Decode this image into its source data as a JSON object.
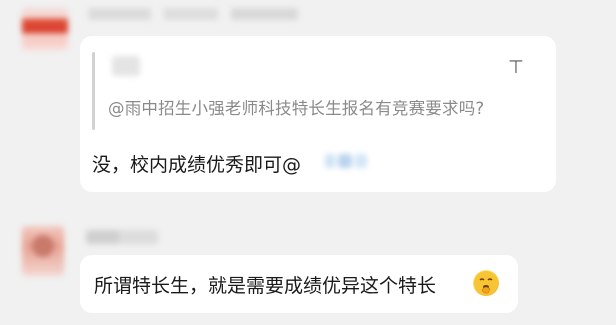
{
  "messages": [
    {
      "sender_name": "",
      "quote": {
        "author": "",
        "text": "@雨中招生小强老师科技特长生报名有竞赛要求吗?"
      },
      "reply": {
        "text": "没，校内成绩优秀即可@"
      },
      "collapse_icon": "collapse-icon",
      "collapse_glyph": "⊤"
    },
    {
      "sender_name": "",
      "text": "所谓特长生，就是需要成绩优异这个特长",
      "emoji": "thinking-emoji"
    }
  ],
  "colors": {
    "background": "#f1f1f1",
    "bubble": "#ffffff",
    "quote_text": "#8a8a8a",
    "text": "#1a1a1a"
  }
}
